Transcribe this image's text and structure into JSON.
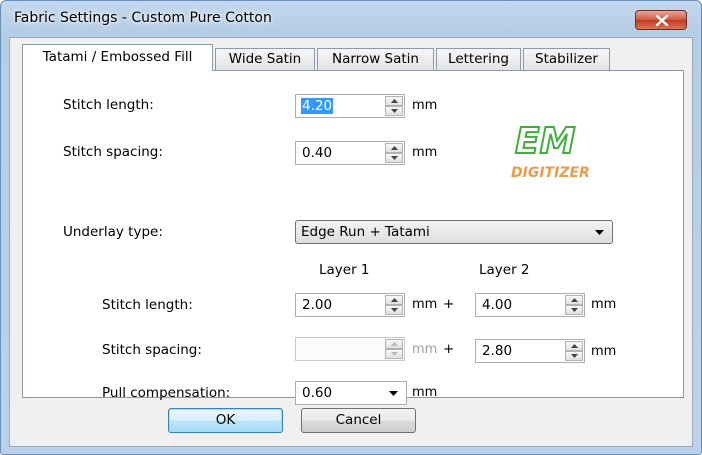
{
  "window": {
    "title": "Fabric Settings - Custom Pure Cotton"
  },
  "tabs": [
    {
      "label": "Tatami / Embossed Fill",
      "active": true
    },
    {
      "label": "Wide Satin",
      "active": false
    },
    {
      "label": "Narrow Satin",
      "active": false
    },
    {
      "label": "Lettering",
      "active": false
    },
    {
      "label": "Stabilizer",
      "active": false
    }
  ],
  "fill": {
    "stitch_length": {
      "label": "Stitch length:",
      "value": "4.20",
      "unit": "mm"
    },
    "stitch_spacing": {
      "label": "Stitch spacing:",
      "value": "0.40",
      "unit": "mm"
    }
  },
  "underlay": {
    "type_label": "Underlay type:",
    "type_value": "Edge Run + Tatami",
    "layer1_header": "Layer 1",
    "layer2_header": "Layer 2",
    "stitch_length": {
      "label": "Stitch length:",
      "layer1": "2.00",
      "layer2": "4.00",
      "unit": "mm",
      "plus": "+"
    },
    "stitch_spacing": {
      "label": "Stitch spacing:",
      "layer1": "",
      "layer2": "2.80",
      "unit": "mm",
      "plus": "+",
      "layer1_disabled": true
    },
    "pull_compensation": {
      "label": "Pull compensation:",
      "value": "0.60",
      "unit": "mm"
    }
  },
  "watermark": {
    "line1": "EM",
    "line2": "DIGITIZER"
  },
  "buttons": {
    "ok": "OK",
    "cancel": "Cancel"
  },
  "colors": {
    "title_bar": "#b9d1ea",
    "close_button": "#c7432b",
    "selection": "#3399ff",
    "watermark_green": "#3fae3a",
    "watermark_orange": "#e98a2b"
  }
}
